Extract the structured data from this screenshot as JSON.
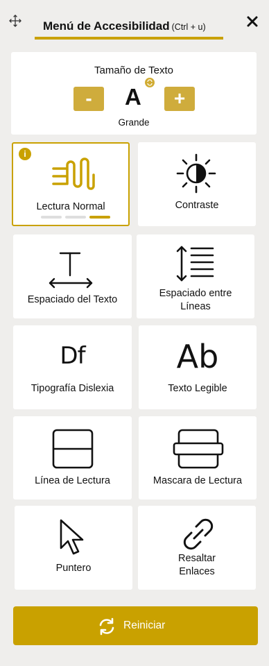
{
  "header": {
    "title": "Menú de Accesibilidad",
    "shortcut": "(Ctrl + u)",
    "icons": {
      "move": "move-arrows-icon",
      "close": "close-icon"
    }
  },
  "text_size": {
    "title": "Tamaño de Texto",
    "decrease_label": "-",
    "increase_label": "+",
    "letter": "A",
    "value": "Grande"
  },
  "tiles": {
    "reading": {
      "label": "Lectura Normal",
      "icon": "reading-wave-icon",
      "levels": 3,
      "active_level": 3,
      "badge": "i"
    },
    "contrast": {
      "label": "Contraste",
      "icon": "contrast-icon"
    },
    "text_spacing": {
      "label": "Espaciado del Texto",
      "icon": "text-spacing-icon"
    },
    "line_spacing": {
      "label_1": "Espaciado entre",
      "label_2": "Líneas",
      "icon": "line-height-icon"
    },
    "dyslexia": {
      "label": "Tipografía Dislexia",
      "icon_text": "Df"
    },
    "legible": {
      "label": "Texto Legible",
      "icon_text": "Ab"
    },
    "reading_line": {
      "label": "Línea de Lectura",
      "icon": "reading-line-icon"
    },
    "reading_mask": {
      "label": "Mascara de Lectura",
      "icon": "reading-mask-icon"
    },
    "pointer": {
      "label": "Puntero",
      "icon": "cursor-pointer-icon"
    },
    "links": {
      "label_1": "Resaltar",
      "label_2": "Enlaces",
      "icon": "link-icon"
    }
  },
  "reset": {
    "label": "Reiniciar",
    "icon": "refresh-icon"
  },
  "colors": {
    "accent": "#c9a100",
    "button": "#cfac3c",
    "background": "#efeeec"
  }
}
